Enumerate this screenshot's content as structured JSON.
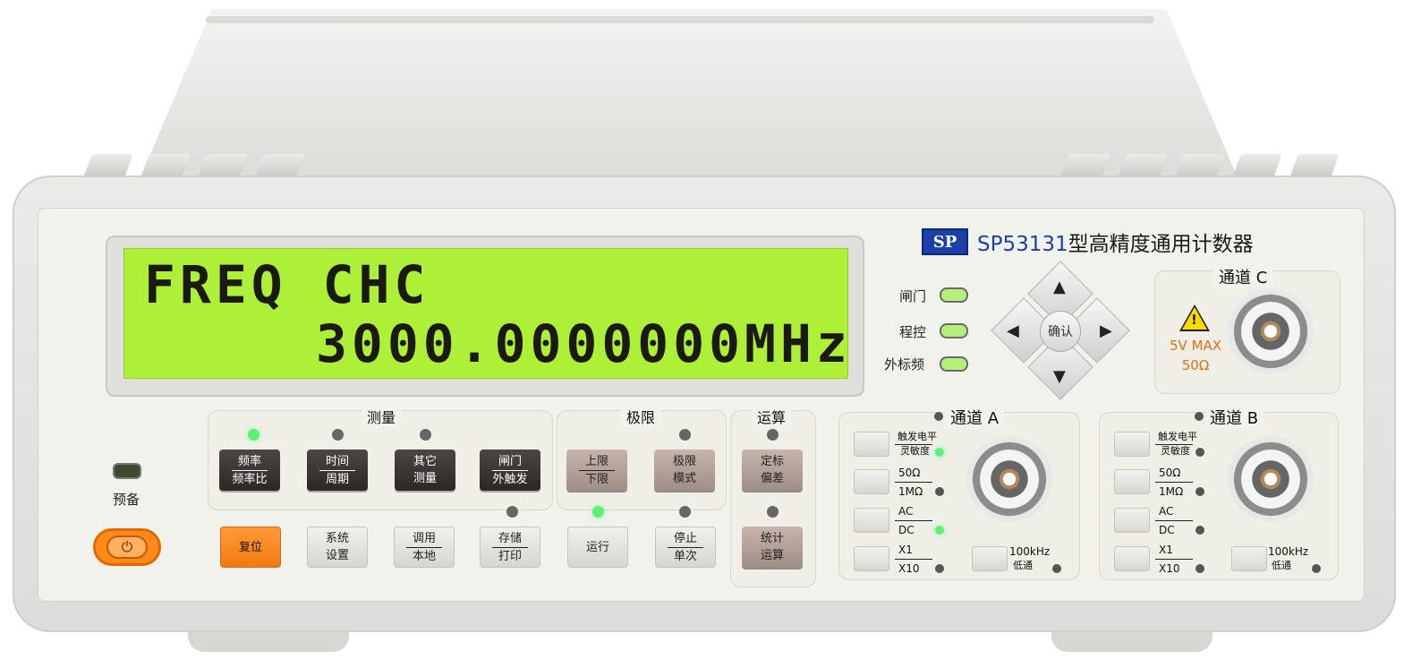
{
  "device": {
    "brand_logo": "SP",
    "model": "SP53131",
    "description": "型高精度通用计数器"
  },
  "display": {
    "line1": "FREQ CHC",
    "line2": "3000.0000000MHz"
  },
  "indicators": [
    {
      "label": "闸门",
      "state": "on"
    },
    {
      "label": "程控",
      "state": "on"
    },
    {
      "label": "外标频",
      "state": "on"
    }
  ],
  "nav": {
    "ok_label": "确认"
  },
  "groups": {
    "measure": "测量",
    "limit": "极限",
    "math": "运算"
  },
  "buttons": {
    "freq": [
      "频率",
      "频率比"
    ],
    "time": [
      "时间",
      "周期"
    ],
    "other": [
      "其它",
      "测量"
    ],
    "gate": [
      "闸门",
      "外触发"
    ],
    "limits": [
      "上限",
      "下限"
    ],
    "limit_mode": [
      "极限",
      "模式"
    ],
    "scale": [
      "定标",
      "偏差"
    ],
    "reset": "复位",
    "system": [
      "系统",
      "设置"
    ],
    "recall": [
      "调用",
      "本地"
    ],
    "store": [
      "存储",
      "打印"
    ],
    "run": "运行",
    "stop": [
      "停止",
      "单次"
    ],
    "stats": [
      "统计",
      "运算"
    ]
  },
  "power": {
    "ready_label": "预备",
    "symbol": "⏻"
  },
  "channel_c": {
    "title": "通道 C",
    "max": "5V MAX",
    "impedance": "50Ω"
  },
  "channel_a": {
    "title": "通道 A",
    "rows": [
      [
        "触发电平",
        "灵敏度"
      ],
      [
        "50Ω",
        "1MΩ"
      ],
      [
        "AC",
        "DC"
      ],
      [
        "X1",
        "X10"
      ]
    ],
    "filter": [
      "100kHz",
      "低通"
    ]
  },
  "channel_b": {
    "title": "通道 B",
    "rows": [
      [
        "触发电平",
        "灵敏度"
      ],
      [
        "50Ω",
        "1MΩ"
      ],
      [
        "AC",
        "DC"
      ],
      [
        "X1",
        "X10"
      ]
    ],
    "filter": [
      "100kHz",
      "低通"
    ]
  },
  "colors": {
    "lcd": "#aef038",
    "led_on": "#5ff07a",
    "accent": "#1d3fa8",
    "power": "#ff8a1a"
  }
}
